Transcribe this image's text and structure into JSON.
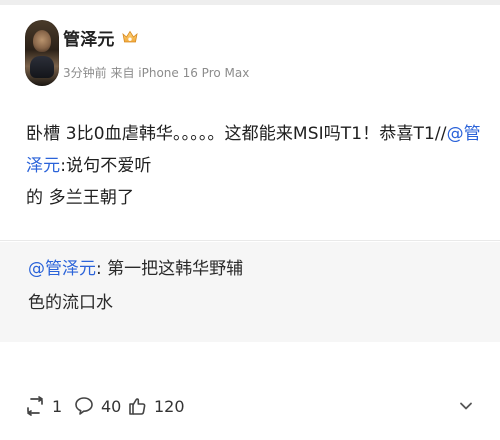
{
  "post": {
    "author": {
      "name": "管泽元",
      "badge_icon": "crown-icon"
    },
    "meta": "3分钟前 来自 iPhone 16 Pro Max",
    "content": {
      "line1_prefix": "卧槽 3比0血虐韩华。。。。。这都能来MSI吗T1！恭喜T1//",
      "mention": "@管泽元",
      "line1_suffix": ":说句不爱听",
      "line2": "的 多兰王朝了"
    },
    "retweet": {
      "mention": "@管泽元",
      "text_part1": ": 第一把这韩华野辅",
      "text_part2": "色的流口水"
    }
  },
  "actions": {
    "repost_count": "1",
    "comment_count": "40",
    "like_count": "120"
  },
  "colors": {
    "mention": "#2b63d9",
    "retweet_background": "#f6f6f6"
  }
}
